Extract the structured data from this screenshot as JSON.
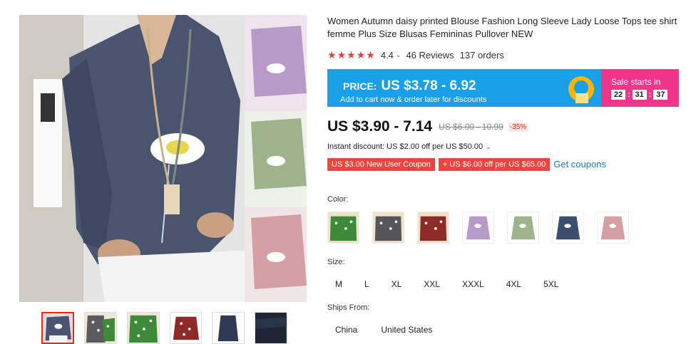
{
  "product": {
    "title": "Women Autumn daisy printed Blouse Fashion Long Sleeve Lady Loose Tops tee shirt femme Plus Size Blusas Femininas Pullover NEW",
    "rating": "4.4",
    "reviews": "46 Reviews",
    "orders": "137 orders"
  },
  "banner": {
    "price_label": "PRICE:",
    "price_value": "US $3.78 - 6.92",
    "subtext": "Add to cart now & order later for discounts",
    "sale_label": "Sale starts in",
    "timer": [
      "22",
      "31",
      "37"
    ],
    "colors": {
      "left": "#1aa0e8",
      "right": "#f0358a"
    }
  },
  "pricing": {
    "sale_price": "US $3.90 - 7.14",
    "original_price": "US $6.00 - 10.99",
    "discount": "-35%",
    "instant_discount": "Instant discount: US $2.00 off per US $50.00"
  },
  "coupons": {
    "new_user": "US $3.00 New User Coupon",
    "store": "+ US $6.00 off per US $65.00",
    "get_coupons": "Get coupons"
  },
  "options": {
    "color_label": "Color:",
    "colors": [
      {
        "name": "green-daisy-print",
        "hex": "#3d8a3a"
      },
      {
        "name": "gray-daisy-print",
        "hex": "#55555a"
      },
      {
        "name": "red-daisy-print",
        "hex": "#8c2a28"
      },
      {
        "name": "purple",
        "hex": "#b89ac9"
      },
      {
        "name": "green",
        "hex": "#9fb38d"
      },
      {
        "name": "navy",
        "hex": "#3c4e6e"
      },
      {
        "name": "pink",
        "hex": "#d4a0a3"
      }
    ],
    "size_label": "Size:",
    "sizes": [
      "M",
      "L",
      "XL",
      "XXL",
      "XXXL",
      "4XL",
      "5XL"
    ],
    "ships_label": "Ships From:",
    "ships": [
      "China",
      "United States"
    ]
  },
  "gallery": {
    "main_shirt_color": "#49546f",
    "thumbs": [
      {
        "name": "thumb-navy",
        "hex": "#49546f"
      },
      {
        "name": "thumb-gray-print",
        "hex": "#5a5a5f"
      },
      {
        "name": "thumb-green-print",
        "hex": "#3d8a3a"
      },
      {
        "name": "thumb-red-print",
        "hex": "#8c2a28"
      },
      {
        "name": "thumb-navy-back",
        "hex": "#2f3b55"
      },
      {
        "name": "thumb-dark-detail",
        "hex": "#1d2433"
      }
    ]
  },
  "accent": {
    "red": "#f23b3b",
    "link": "#1a7dc9"
  }
}
